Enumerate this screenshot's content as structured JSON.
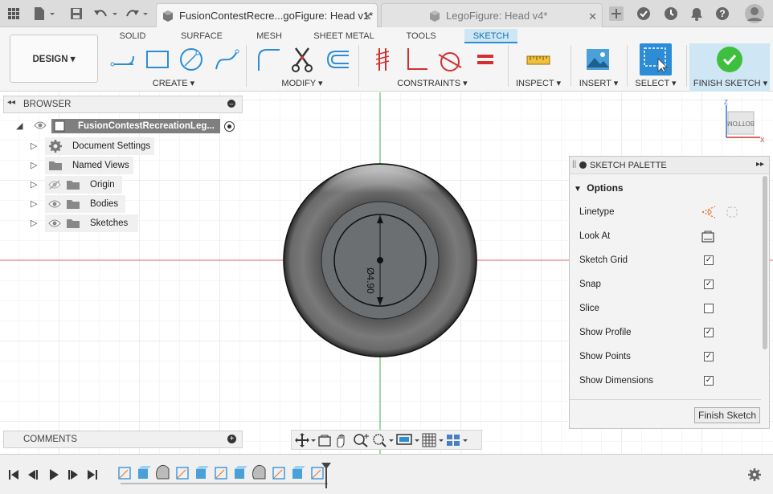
{
  "titlebar": {
    "tabs": [
      {
        "label": "FusionContestRecre...goFigure: Head v1*",
        "close": "✕"
      },
      {
        "label": "LegoFigure: Head v4*",
        "close": "✕"
      }
    ],
    "icons": [
      "grid-icon",
      "file-icon",
      "save-icon",
      "undo-icon",
      "redo-icon",
      "add-tab-icon",
      "offline-icon",
      "history-icon",
      "notifications-icon",
      "help-icon",
      "user-avatar-icon"
    ]
  },
  "toolbar": {
    "mode_tabs": [
      "SOLID",
      "SURFACE",
      "MESH",
      "SHEET METAL",
      "TOOLS",
      "SKETCH"
    ],
    "active_tab": "SKETCH",
    "workspace_label": "DESIGN ▾",
    "groups": {
      "create": "CREATE ▾",
      "modify": "MODIFY ▾",
      "constraints": "CONSTRAINTS ▾",
      "inspect": "INSPECT ▾",
      "insert": "INSERT ▾",
      "select": "SELECT ▾",
      "finish": "FINISH SKETCH ▾"
    },
    "accent": "#2c8dd6",
    "finish_color": "#3fbf3f"
  },
  "browser": {
    "header": "BROWSER",
    "root": "FusionContestRecreationLeg...",
    "items": [
      "Document Settings",
      "Named Views",
      "Origin",
      "Bodies",
      "Sketches"
    ]
  },
  "comments": {
    "label": "COMMENTS"
  },
  "viewcube": {
    "face_label": "BOTTOM",
    "z_label": "Z",
    "x_label": "X"
  },
  "dimension": {
    "label": "Ø4.90"
  },
  "palette": {
    "header": "SKETCH PALETTE",
    "section": "Options",
    "rows": [
      {
        "label": "Linetype",
        "kind": "icons"
      },
      {
        "label": "Look At",
        "kind": "icon"
      },
      {
        "label": "Sketch Grid",
        "checked": "✓"
      },
      {
        "label": "Snap",
        "checked": "✓"
      },
      {
        "label": "Slice",
        "checked": ""
      },
      {
        "label": "Show Profile",
        "checked": "✓"
      },
      {
        "label": "Show Points",
        "checked": "✓"
      },
      {
        "label": "Show Dimensions",
        "checked": "✓"
      }
    ],
    "finish_button": "Finish Sketch"
  },
  "nav_bar": {
    "icons": [
      "orbit-icon",
      "look-at-icon",
      "pan-icon",
      "zoom-window-icon",
      "zoom-icon",
      "display-settings-icon",
      "grid-settings-icon",
      "viewports-icon"
    ]
  },
  "timeline": {
    "controls": [
      "first-icon",
      "previous-icon",
      "play-icon",
      "next-icon",
      "last-icon"
    ],
    "settings": "gear-icon"
  }
}
